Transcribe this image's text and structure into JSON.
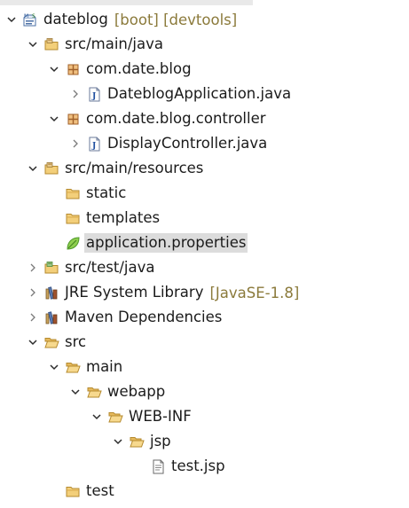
{
  "tree": [
    {
      "name": "project-dateblog",
      "label": "dateblog",
      "decoration": "[boot] [devtools]",
      "depth": 0,
      "state": "expanded",
      "icon": "spring-project-icon"
    },
    {
      "name": "source-folder-src-main-java",
      "label": "src/main/java",
      "depth": 1,
      "state": "expanded",
      "icon": "source-folder-icon"
    },
    {
      "name": "package-com-date-blog",
      "label": "com.date.blog",
      "depth": 2,
      "state": "expanded",
      "icon": "package-icon"
    },
    {
      "name": "file-dateblogapplication-java",
      "label": "DateblogApplication.java",
      "depth": 3,
      "state": "collapsed",
      "icon": "java-file-icon"
    },
    {
      "name": "package-com-date-blog-controller",
      "label": "com.date.blog.controller",
      "depth": 2,
      "state": "expanded",
      "icon": "package-icon"
    },
    {
      "name": "file-displaycontroller-java",
      "label": "DisplayController.java",
      "depth": 3,
      "state": "collapsed",
      "icon": "java-file-icon"
    },
    {
      "name": "source-folder-src-main-resources",
      "label": "src/main/resources",
      "depth": 1,
      "state": "expanded",
      "icon": "source-folder-icon"
    },
    {
      "name": "folder-static",
      "label": "static",
      "depth": 2,
      "state": "leaf",
      "icon": "folder-icon"
    },
    {
      "name": "folder-templates",
      "label": "templates",
      "depth": 2,
      "state": "leaf",
      "icon": "folder-icon"
    },
    {
      "name": "file-application-properties",
      "label": "application.properties",
      "depth": 2,
      "state": "leaf",
      "icon": "spring-leaf-icon",
      "selected": true
    },
    {
      "name": "source-folder-src-test-java",
      "label": "src/test/java",
      "depth": 1,
      "state": "collapsed",
      "icon": "test-source-folder-icon"
    },
    {
      "name": "library-jre-system",
      "label": "JRE System Library",
      "decoration": "[JavaSE-1.8]",
      "depth": 1,
      "state": "collapsed",
      "icon": "library-icon"
    },
    {
      "name": "library-maven-dependencies",
      "label": "Maven Dependencies",
      "depth": 1,
      "state": "collapsed",
      "icon": "library-icon"
    },
    {
      "name": "folder-src",
      "label": "src",
      "depth": 1,
      "state": "expanded",
      "icon": "folder-open-icon"
    },
    {
      "name": "folder-main",
      "label": "main",
      "depth": 2,
      "state": "expanded",
      "icon": "folder-open-icon"
    },
    {
      "name": "folder-webapp",
      "label": "webapp",
      "depth": 3,
      "state": "expanded",
      "icon": "folder-open-icon"
    },
    {
      "name": "folder-web-inf",
      "label": "WEB-INF",
      "depth": 4,
      "state": "expanded",
      "icon": "folder-open-icon"
    },
    {
      "name": "folder-jsp",
      "label": "jsp",
      "depth": 5,
      "state": "expanded",
      "icon": "folder-open-icon"
    },
    {
      "name": "file-test-jsp",
      "label": "test.jsp",
      "depth": 6,
      "state": "leaf",
      "icon": "jsp-file-icon"
    },
    {
      "name": "folder-test",
      "label": "test",
      "depth": 2,
      "state": "leaf",
      "icon": "folder-icon"
    }
  ]
}
